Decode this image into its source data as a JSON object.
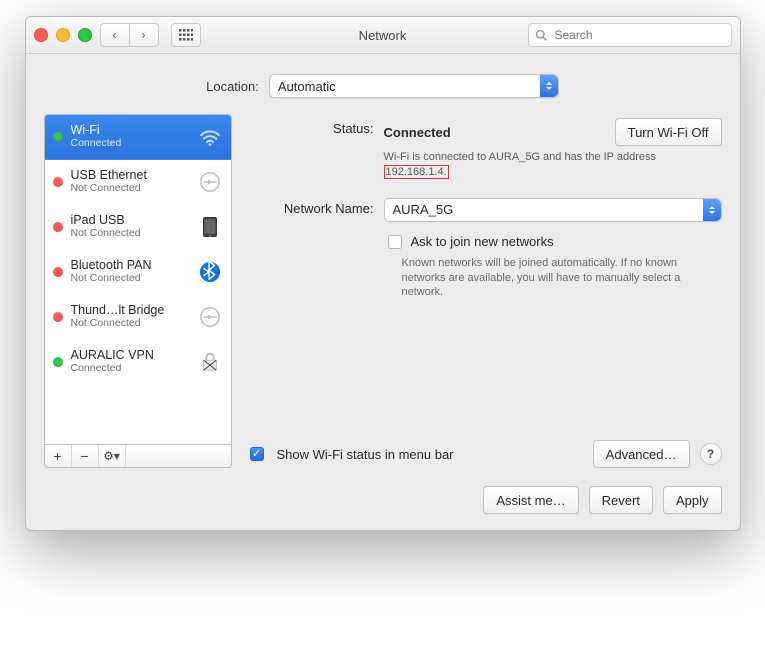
{
  "window_title": "Network",
  "search_placeholder": "Search",
  "location": {
    "label": "Location:",
    "value": "Automatic"
  },
  "services": [
    {
      "name": "Wi-Fi",
      "status": "Connected",
      "dot": "green",
      "icon": "wifi",
      "selected": true
    },
    {
      "name": "USB Ethernet",
      "status": "Not Connected",
      "dot": "red",
      "icon": "ethernet",
      "selected": false
    },
    {
      "name": "iPad USB",
      "status": "Not Connected",
      "dot": "red",
      "icon": "ipad",
      "selected": false
    },
    {
      "name": "Bluetooth PAN",
      "status": "Not Connected",
      "dot": "red",
      "icon": "bluetooth",
      "selected": false
    },
    {
      "name": "Thund…lt Bridge",
      "status": "Not Connected",
      "dot": "red",
      "icon": "ethernet",
      "selected": false
    },
    {
      "name": "AURALIC VPN",
      "status": "Connected",
      "dot": "green",
      "icon": "vpn",
      "selected": false
    }
  ],
  "sidebar_buttons": {
    "add": "+",
    "remove": "−",
    "actions": "⚙︎▾"
  },
  "detail": {
    "status_label": "Status:",
    "status_value": "Connected",
    "turn_off_label": "Turn Wi-Fi Off",
    "desc_prefix": "Wi-Fi is connected to AURA_5G and has the IP address",
    "desc_ip": "192.168.1.4.",
    "network_name_label": "Network Name:",
    "network_name_value": "AURA_5G",
    "ask_join_label": "Ask to join new networks",
    "ask_join_checked": false,
    "ask_join_desc": "Known networks will be joined automatically. If no known networks are available, you will have to manually select a network.",
    "show_status_label": "Show Wi-Fi status in menu bar",
    "show_status_checked": true,
    "advanced_label": "Advanced…",
    "help_tooltip": "?"
  },
  "buttons": {
    "assist": "Assist me…",
    "revert": "Revert",
    "apply": "Apply"
  }
}
